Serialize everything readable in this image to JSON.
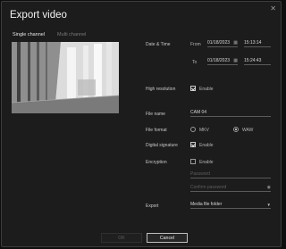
{
  "dialog": {
    "title": "Export video"
  },
  "tabs": [
    "Single channel",
    "Multi channel"
  ],
  "date_time": {
    "label": "Date & Time",
    "from_label": "From",
    "to_label": "To",
    "from_date": "01/18/2023",
    "from_time": "15:13:14",
    "to_date": "01/18/2023",
    "to_time": "15:24:43"
  },
  "high_resolution": {
    "label": "High resolution",
    "option": "Enable",
    "checked": true
  },
  "file_name": {
    "label": "File name",
    "value": "CAM 04"
  },
  "file_format": {
    "label": "File format",
    "options": [
      "MKV",
      "WAW"
    ],
    "selected": "WAW"
  },
  "digital_signature": {
    "label": "Digital signature",
    "option": "Enable",
    "checked": true
  },
  "encryption": {
    "label": "Encryption",
    "option": "Enable",
    "checked": false,
    "password_placeholder": "Password",
    "confirm_placeholder": "Confirm password"
  },
  "export": {
    "label": "Export",
    "value": "Media file folder"
  },
  "buttons": {
    "ok": "OK",
    "cancel": "Cancel"
  },
  "icons": [
    "close-icon",
    "calendar-icon",
    "eye-icon",
    "chevron-down-icon"
  ]
}
